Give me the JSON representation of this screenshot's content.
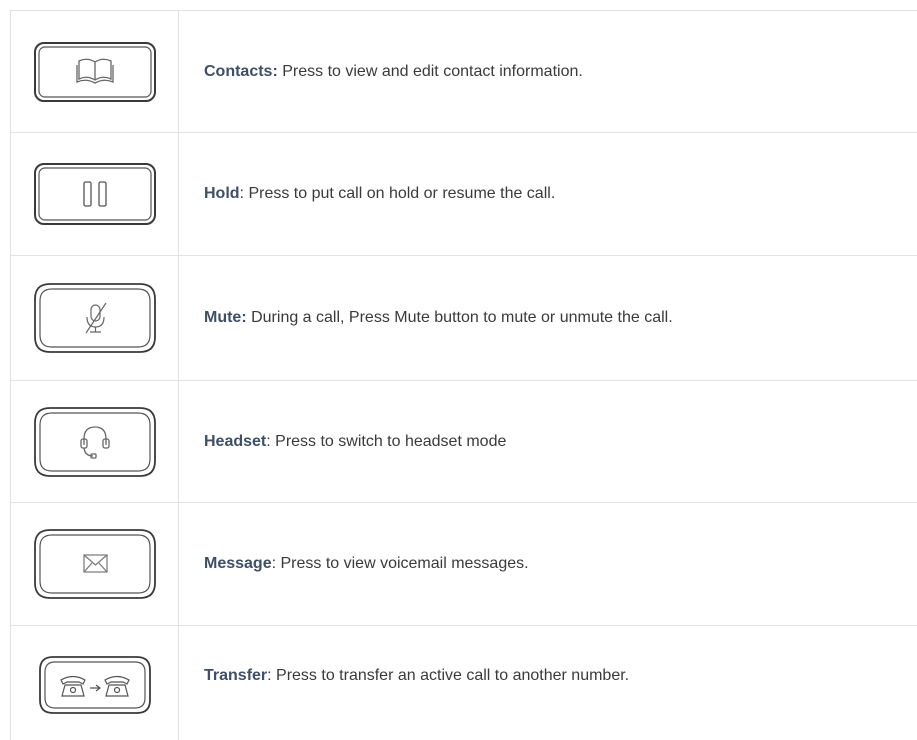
{
  "rows": [
    {
      "name": "Contacts:",
      "desc": " Press to view and edit contact information.",
      "icon": "contacts-book-icon"
    },
    {
      "name": "Hold",
      "desc": ": Press to put call on hold or resume the call.",
      "icon": "hold-pause-icon"
    },
    {
      "name": "Mute:",
      "desc": " During a call, Press Mute button to mute or unmute the call.",
      "icon": "mute-microphone-icon"
    },
    {
      "name": "Headset",
      "desc": ": Press to switch to headset mode",
      "icon": "headset-icon"
    },
    {
      "name": "Message",
      "desc": ": Press to view voicemail messages.",
      "icon": "envelope-icon"
    },
    {
      "name": "Transfer",
      "desc": ": Press to transfer an active call to another number.",
      "icon": "transfer-phones-icon"
    }
  ]
}
